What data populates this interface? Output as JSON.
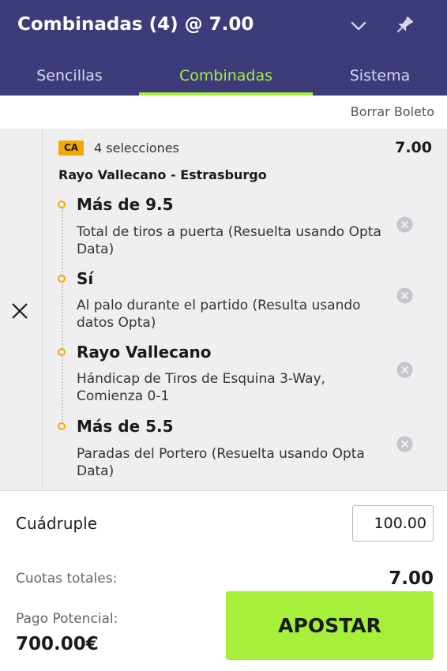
{
  "header": {
    "title": "Combinadas (4) @ 7.00",
    "tabs": [
      "Sencillas",
      "Combinadas",
      "Sistema"
    ],
    "active_tab": "Combinadas"
  },
  "clear_label": "Borrar Boleto",
  "slip": {
    "badge": "CA",
    "selection_count": "4 selecciones",
    "total_odds": "7.00",
    "event": "Rayo Vallecano - Estrasburgo",
    "legs": [
      {
        "title": "Más de 9.5",
        "market": "Total de tiros a puerta (Resuelta usando Opta Data)"
      },
      {
        "title": "Sí",
        "market": "Al palo durante el partido (Resulta usando datos Opta)"
      },
      {
        "title": "Rayo Vallecano",
        "market": "Hándicap de Tiros de Esquina 3-Way, Comienza 0-1"
      },
      {
        "title": "Más de 5.5",
        "market": "Paradas del Portero (Resuelta usando Opta Data)"
      }
    ]
  },
  "bet": {
    "type": "Cuádruple",
    "stake": "100.00",
    "odds_label": "Cuotas totales:",
    "odds_value": "7.00",
    "payout_label": "Pago Potencial:",
    "payout_value": "700.00€",
    "button": "APOSTAR"
  },
  "colors": {
    "header_bg": "#3d3b7a",
    "accent": "#a6f03a",
    "badge": "#f2a900",
    "panel_bg": "#efeff1"
  },
  "icons": {
    "collapse": "chevron-down-icon",
    "pin": "pin-icon",
    "remove_all": "close-icon",
    "remove_leg": "circle-x-icon"
  }
}
